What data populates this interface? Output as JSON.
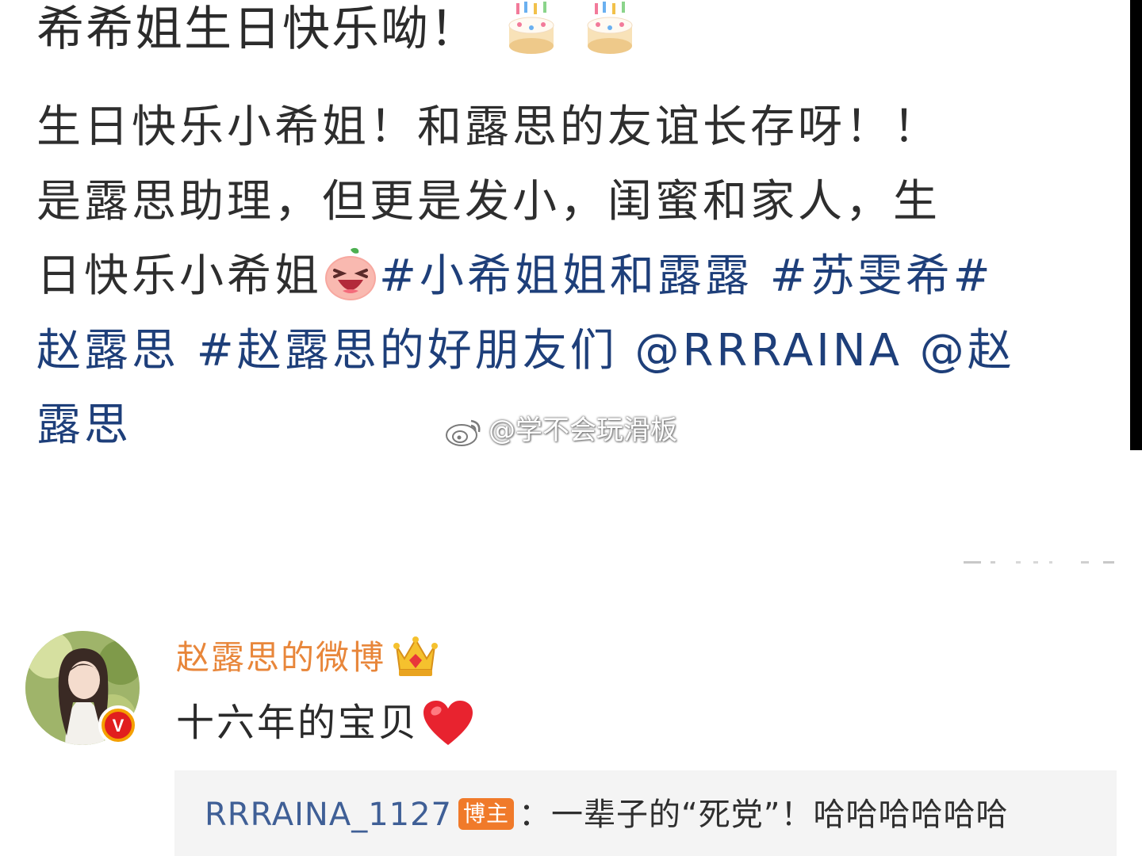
{
  "post": {
    "title": "希希姐生日快乐呦！",
    "title_emojis": [
      "cake-icon",
      "cake-icon"
    ],
    "line1": "生日快乐小希姐！和露思的友谊长存呀！！",
    "line2": "是露思助理，但更是发小，闺蜜和家人，生",
    "line3_text": "日快乐小希姐",
    "line3_emoji": "laughing-peach-icon",
    "line3_tags": "#小希姐姐和露露 #苏雯希#",
    "line4_text": "赵露思 #赵露思的好朋友们 @RRRAINA @赵",
    "line5_text": "露思",
    "link_color": "#1e3f7a"
  },
  "watermark": {
    "icon": "weibo-logo-icon",
    "text": "@学不会玩滑板"
  },
  "comment": {
    "username": "赵露思的微博",
    "username_color": "#e8863a",
    "crown_icon": "crown-icon",
    "avatar": "avatar",
    "verified_icon": "verified-v-icon",
    "verified_letter": "V",
    "text": "十六年的宝贝",
    "heart_icon": "red-heart-icon",
    "reply": {
      "username": "RRRAINA_1127",
      "badge": "博主",
      "separator": "：",
      "text": "一辈子的“死党”！哈哈哈哈哈哈"
    }
  }
}
